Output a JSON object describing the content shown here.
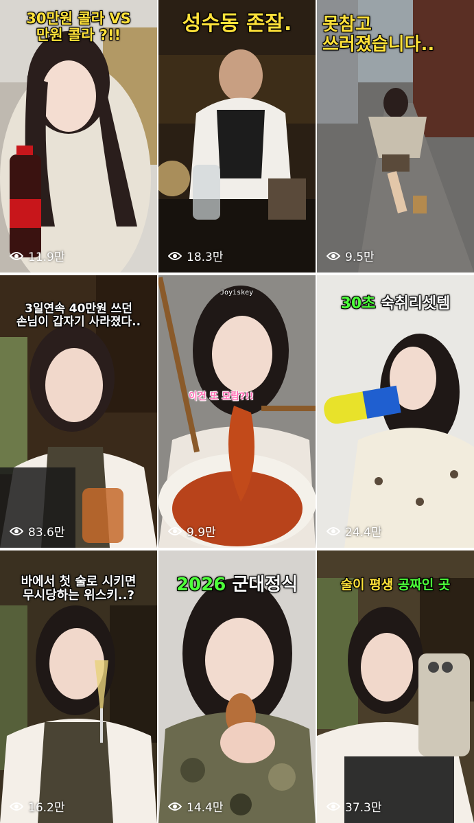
{
  "tiles": [
    {
      "caption_lines": [
        "30만원 콜라 VS",
        "만원 콜라 ?!!"
      ],
      "views": "11.9만",
      "caption_color": "yellow",
      "bottle_label": "Coca-Cola"
    },
    {
      "caption_lines": [
        "성수동 존잘."
      ],
      "views": "18.3만",
      "caption_color": "yellow"
    },
    {
      "caption_lines": [
        "못참고",
        "쓰러졌습니다.."
      ],
      "views": "9.5만",
      "caption_color": "yellow"
    },
    {
      "caption_lines": [
        "3일연속 40만원 쓰던",
        "손님이 갑자기 사라졌다.."
      ],
      "views": "83.6만",
      "caption_color": "white"
    },
    {
      "caption_lines": [],
      "views": "9.9만",
      "small_label": "Joyiskey",
      "pink_label": "이건 또 모람?!!"
    },
    {
      "caption_lines": [
        "30초 숙취리셋템"
      ],
      "caption_parts": [
        "30초",
        "숙취리셋템"
      ],
      "views": "24.4만"
    },
    {
      "caption_lines": [
        "바에서 첫 술로 시키면",
        "무시당하는 위스키..?"
      ],
      "views": "16.2만",
      "caption_color": "white"
    },
    {
      "caption_lines": [
        "2026 군대정식"
      ],
      "caption_parts": [
        "2026",
        "군대정식"
      ],
      "views": "14.4만"
    },
    {
      "caption_lines": [
        "술이 평생 공짜인 곳"
      ],
      "caption_parts": [
        "술이 평생",
        "공짜인 곳"
      ],
      "views": "37.3만"
    }
  ],
  "colors": {
    "yellow": "#ffe23a",
    "green": "#4dff3a",
    "white": "#ffffff"
  },
  "icons": {
    "views": "eye-icon"
  }
}
